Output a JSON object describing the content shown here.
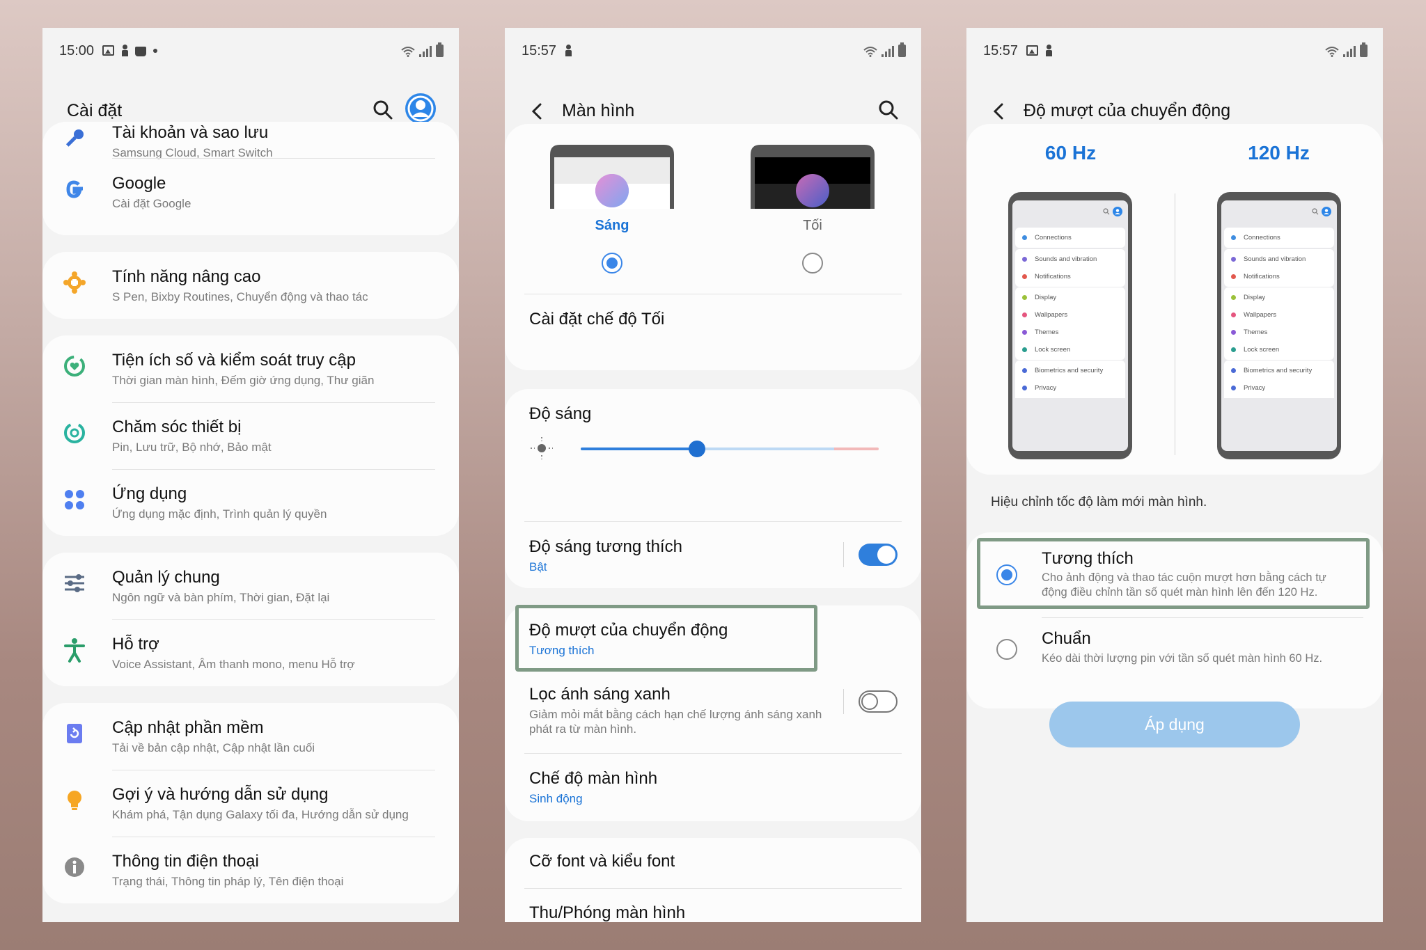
{
  "phone1": {
    "status_time": "15:00",
    "title": "Cài đặt",
    "items": [
      {
        "title": "Tài khoản và sao lưu",
        "subtitle": "Samsung Cloud, Smart Switch"
      },
      {
        "title": "Google",
        "subtitle": "Cài đặt Google"
      },
      {
        "title": "Tính năng nâng cao",
        "subtitle": "S Pen, Bixby Routines, Chuyển động và thao tác"
      },
      {
        "title": "Tiện ích số và kiểm soát truy cập",
        "subtitle": "Thời gian màn hình, Đếm giờ ứng dụng, Thư giãn"
      },
      {
        "title": "Chăm sóc thiết bị",
        "subtitle": "Pin, Lưu trữ, Bộ nhớ, Bảo mật"
      },
      {
        "title": "Ứng dụng",
        "subtitle": "Ứng dụng mặc định, Trình quản lý quyền"
      },
      {
        "title": "Quản lý chung",
        "subtitle": "Ngôn ngữ và bàn phím, Thời gian, Đặt lại"
      },
      {
        "title": "Hỗ trợ",
        "subtitle": "Voice Assistant, Âm thanh mono, menu Hỗ trợ"
      },
      {
        "title": "Cập nhật phần mềm",
        "subtitle": "Tải về bản cập nhật, Cập nhật lần cuối"
      },
      {
        "title": "Gợi ý và hướng dẫn sử dụng",
        "subtitle": "Khám phá, Tận dụng Galaxy tối đa, Hướng dẫn sử dụng"
      },
      {
        "title": "Thông tin điện thoại",
        "subtitle": "Trạng thái, Thông tin pháp lý, Tên điện thoại"
      }
    ]
  },
  "phone2": {
    "status_time": "15:57",
    "title": "Màn hình",
    "theme_light": "Sáng",
    "theme_dark": "Tối",
    "theme_selected": "light",
    "dark_mode_settings": "Cài đặt chế độ Tối",
    "brightness_label": "Độ sáng",
    "brightness_level_percent": 39,
    "adaptive_brightness": {
      "title": "Độ sáng tương thích",
      "subtitle": "Bật",
      "enabled": true
    },
    "motion_smoothness": {
      "title": "Độ mượt của chuyển động",
      "subtitle": "Tương thích"
    },
    "blue_light_filter": {
      "title": "Lọc ánh sáng xanh",
      "line1": "Giảm mỏi mắt bằng cách hạn chế lượng ánh sáng xanh",
      "line2": "phát ra từ màn hình.",
      "enabled": false
    },
    "screen_mode": {
      "title": "Chế độ màn hình",
      "subtitle": "Sinh động"
    },
    "font_size": "Cỡ font và kiểu font",
    "screen_zoom": "Thu/Phóng màn hình"
  },
  "phone3": {
    "status_time": "15:57",
    "title": "Độ mượt của chuyển động",
    "hz60": "60 Hz",
    "hz120": "120 Hz",
    "mini_items": [
      {
        "label": "Connections",
        "color": "#3f8de0"
      },
      {
        "label": "Sounds and vibration",
        "color": "#7b68d6"
      },
      {
        "label": "Notifications",
        "color": "#e2584e"
      },
      {
        "label": "Display",
        "color": "#9bc13a"
      },
      {
        "label": "Wallpapers",
        "color": "#e5557f"
      },
      {
        "label": "Themes",
        "color": "#8a5ad6"
      },
      {
        "label": "Lock screen",
        "color": "#2a9d8f"
      },
      {
        "label": "Biometrics and security",
        "color": "#4a6ad6"
      },
      {
        "label": "Privacy",
        "color": "#4a6ad6"
      }
    ],
    "description": "Hiệu chỉnh tốc độ làm mới màn hình.",
    "option_adaptive": {
      "title": "Tương thích",
      "line1": "Cho ảnh động và thao tác cuộn mượt hơn bằng cách tự",
      "line2": "động điều chỉnh tần số quét màn hình lên đến 120 Hz."
    },
    "option_standard": {
      "title": "Chuẩn",
      "line1": "Kéo dài thời lượng pin với tần số quét màn hình 60 Hz."
    },
    "apply_label": "Áp dụng"
  },
  "colors": {
    "accent": "#1a73d6",
    "highlight": "#7f9a85",
    "apply_button": "#9cc7ec"
  }
}
